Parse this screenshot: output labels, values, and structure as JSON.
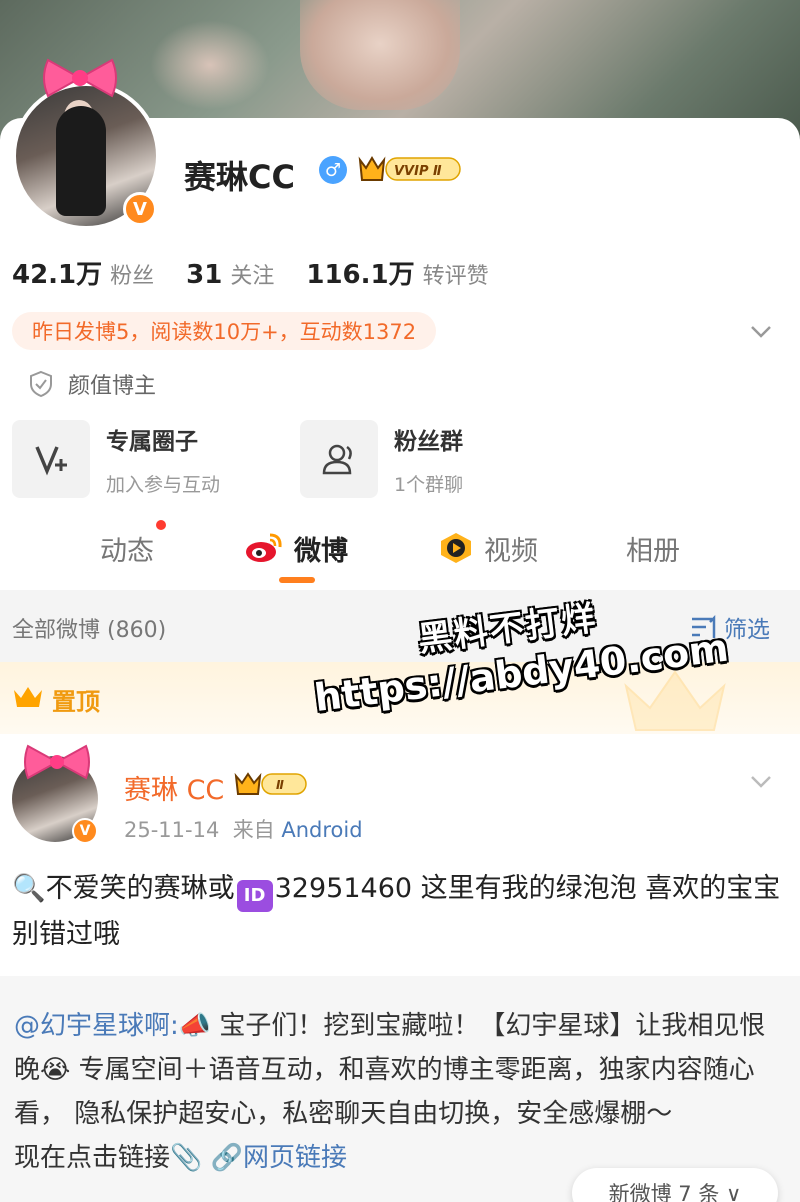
{
  "profile": {
    "name": "赛琳CC",
    "verified_badge": "V",
    "gender_symbol": "♂",
    "vip_label": "VVIP Ⅱ"
  },
  "stats": [
    {
      "num": "42.1万",
      "label": "粉丝"
    },
    {
      "num": "31",
      "label": "关注"
    },
    {
      "num": "116.1万",
      "label": "转评赞"
    }
  ],
  "summary_pill": "昨日发博5，阅读数10万+，互动数1372",
  "tagline": "颜值博主",
  "features": [
    {
      "title": "专属圈子",
      "subtitle": "加入参与互动",
      "icon": "circle-v-plus-icon"
    },
    {
      "title": "粉丝群",
      "subtitle": "1个群聊",
      "icon": "group-icon"
    }
  ],
  "tabs": [
    {
      "label": "动态",
      "has_dot": true
    },
    {
      "label": "微博",
      "active": true
    },
    {
      "label": "视频"
    },
    {
      "label": "相册"
    }
  ],
  "filterbar": {
    "count": "全部微博 (860)",
    "filter_label": "筛选"
  },
  "pinned_label": "置顶",
  "watermark": {
    "line1": "黑料不打烊",
    "line2": "https://abdy40.com"
  },
  "post": {
    "author": "赛琳 CC",
    "vip_label": "Ⅱ",
    "date": "25-11-14",
    "from": "来自",
    "source": "Android",
    "text_part1": "不爱笑的赛琳或",
    "id_badge": "ID",
    "text_part2": "32951460 这里有我的绿泡泡 喜欢的宝宝别错过哦"
  },
  "repost": {
    "at": "@幻宇星球啊:",
    "text": " 宝子们！挖到宝藏啦！【幻宇星球】让我相见恨晚😭 专属空间＋语音互动，和喜欢的博主零距离，独家内容随心看， 隐私保护超安心，私密聊天自由切换，安全感爆棚～",
    "line_last": "现在点击链接",
    "link": "网页链接"
  },
  "new_posts_button": "新微博 7 条 ∨",
  "colors": {
    "accent_orange": "#ff7f1e",
    "link_blue": "#4a7ab8",
    "pill_bg": "#fff1ea"
  }
}
